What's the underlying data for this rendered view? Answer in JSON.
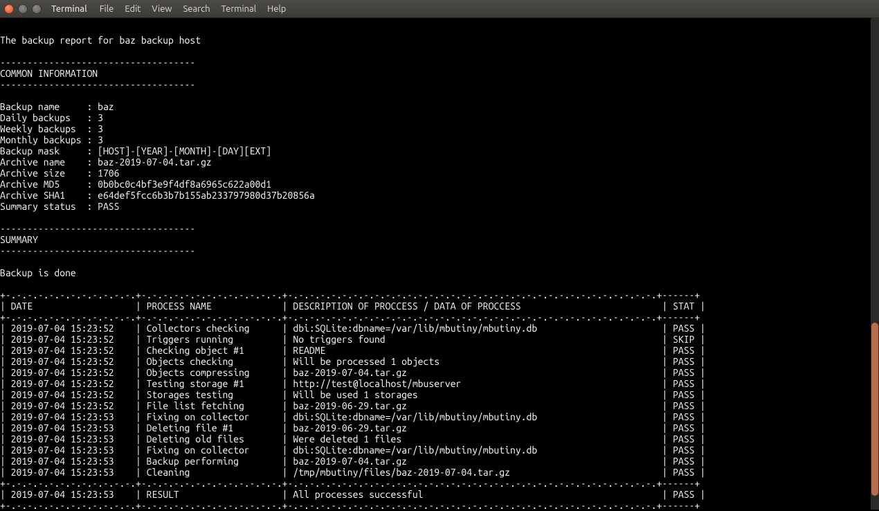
{
  "window": {
    "app_title": "Terminal"
  },
  "menu": {
    "file": "File",
    "edit": "Edit",
    "view": "View",
    "search": "Search",
    "terminal": "Terminal",
    "help": "Help"
  },
  "report": {
    "title_line": "The backup report for baz backup host",
    "dash_line": "------------------------------------",
    "common_header": "COMMON INFORMATION",
    "summary_header": "SUMMARY",
    "summary_text": "Backup is done",
    "common_info": [
      {
        "label": "Backup name     ",
        "value": "baz"
      },
      {
        "label": "Daily backups   ",
        "value": "3"
      },
      {
        "label": "Weekly backups  ",
        "value": "3"
      },
      {
        "label": "Monthly backups ",
        "value": "3"
      },
      {
        "label": "Backup mask     ",
        "value": "[HOST]-[YEAR]-[MONTH]-[DAY][EXT]"
      },
      {
        "label": "Archive name    ",
        "value": "baz-2019-07-04.tar.gz"
      },
      {
        "label": "Archive size    ",
        "value": "1706"
      },
      {
        "label": "Archive MD5     ",
        "value": "0b0bc0c4bf3e9f4df8a6965c622a00d1"
      },
      {
        "label": "Archive SHA1    ",
        "value": "e64def5fcc6b3b7b155ab233797980d37b20856a"
      },
      {
        "label": "Summary status  ",
        "value": "PASS"
      }
    ],
    "table": {
      "border": "+-.-.-.-.-.-.-.-.-.-.-.-.+-.-.-.-.-.-.-.-.-.-.-.-.-.+-.-.-.-.-.-.-.-.-.-.-.-.-.-.-.-.-.-.-.-.-.-.-.-.-.-.-.-.-.-.-.-.-.-.+------+",
      "header": {
        "date": "DATE",
        "process": "PROCESS NAME",
        "desc": "DESCRIPTION OF PROCCESS / DATA OF PROCCESS",
        "stat": "STAT"
      },
      "rows": [
        {
          "date": "2019-07-04 15:23:52",
          "process": "Collectors checking",
          "desc": "dbi:SQLite:dbname=/var/lib/mbutiny/mbutiny.db",
          "stat": "PASS"
        },
        {
          "date": "2019-07-04 15:23:52",
          "process": "Triggers running",
          "desc": "No triggers found",
          "stat": "SKIP"
        },
        {
          "date": "2019-07-04 15:23:52",
          "process": "Checking object #1",
          "desc": "README",
          "stat": "PASS"
        },
        {
          "date": "2019-07-04 15:23:52",
          "process": "Objects checking",
          "desc": "Will be processed 1 objects",
          "stat": "PASS"
        },
        {
          "date": "2019-07-04 15:23:52",
          "process": "Objects compressing",
          "desc": "baz-2019-07-04.tar.gz",
          "stat": "PASS"
        },
        {
          "date": "2019-07-04 15:23:52",
          "process": "Testing storage #1",
          "desc": "http://test@localhost/mbuserver",
          "stat": "PASS"
        },
        {
          "date": "2019-07-04 15:23:52",
          "process": "Storages testing",
          "desc": "Will be used 1 storages",
          "stat": "PASS"
        },
        {
          "date": "2019-07-04 15:23:52",
          "process": "File list fetching",
          "desc": "baz-2019-06-29.tar.gz",
          "stat": "PASS"
        },
        {
          "date": "2019-07-04 15:23:53",
          "process": "Fixing on collector",
          "desc": "dbi:SQLite:dbname=/var/lib/mbutiny/mbutiny.db",
          "stat": "PASS"
        },
        {
          "date": "2019-07-04 15:23:53",
          "process": "Deleting file #1",
          "desc": "baz-2019-06-29.tar.gz",
          "stat": "PASS"
        },
        {
          "date": "2019-07-04 15:23:53",
          "process": "Deleting old files",
          "desc": "Were deleted 1 files",
          "stat": "PASS"
        },
        {
          "date": "2019-07-04 15:23:53",
          "process": "Fixing on collector",
          "desc": "dbi:SQLite:dbname=/var/lib/mbutiny/mbutiny.db",
          "stat": "PASS"
        },
        {
          "date": "2019-07-04 15:23:53",
          "process": "Backup performing",
          "desc": "baz-2019-07-04.tar.gz",
          "stat": "PASS"
        },
        {
          "date": "2019-07-04 15:23:53",
          "process": "Cleaning",
          "desc": "/tmp/mbutiny/files/baz-2019-07-04.tar.gz",
          "stat": "PASS"
        }
      ],
      "footer": {
        "date": "2019-07-04 15:23:53",
        "process": "RESULT",
        "desc": "All processes successful",
        "stat": "PASS"
      }
    }
  }
}
